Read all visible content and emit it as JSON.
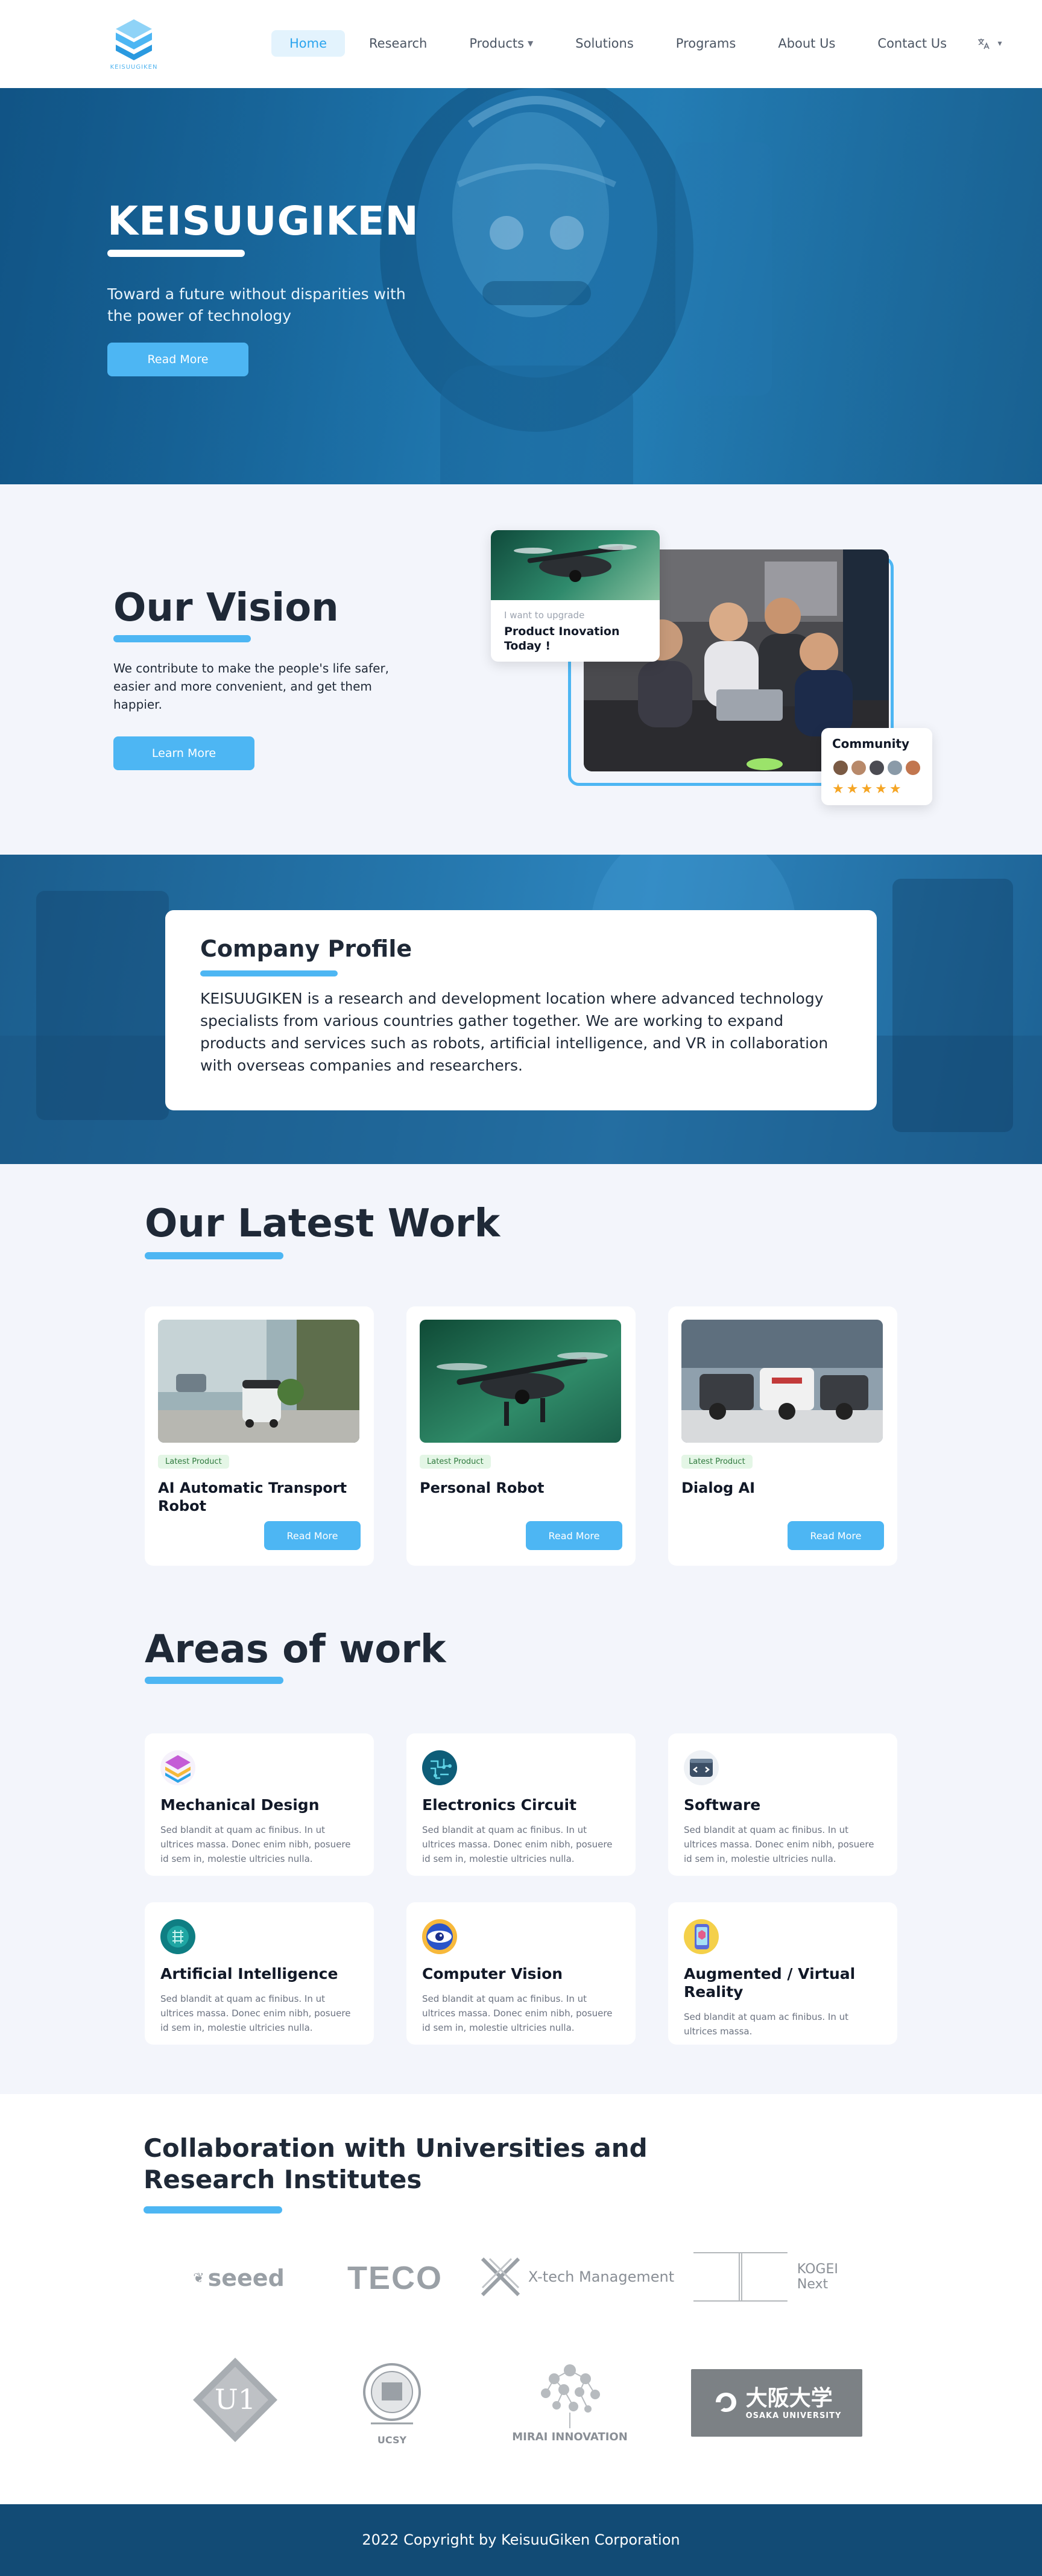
{
  "brand": {
    "logo_text": "KEISUUGIKEN",
    "accent": "#4db6f3"
  },
  "nav": {
    "items": [
      {
        "label": "Home",
        "active": true
      },
      {
        "label": "Research"
      },
      {
        "label": "Products",
        "dropdown": true
      },
      {
        "label": "Solutions"
      },
      {
        "label": "Programs"
      },
      {
        "label": "About Us"
      },
      {
        "label": "Contact Us"
      }
    ],
    "language_icon": "translate-icon"
  },
  "hero": {
    "title": "KEISUUGIKEN",
    "subtitle": "Toward a future without disparities with the power of technology",
    "button": "Read More"
  },
  "vision": {
    "title": "Our Vision",
    "text": "We contribute to make the people's life safer, easier and more convenient, and get them happier.",
    "button": "Learn More",
    "upgrade_small": "I want to upgrade",
    "upgrade_big": "Product Inovation Today !",
    "community_title": "Community",
    "rating": 5
  },
  "profile": {
    "title": "Company Profile",
    "text": "KEISUUGIKEN is a research and development location where advanced technology specialists from various countries gather together. We are working to expand products and services such as robots, artificial intelligence, and VR in collaboration with overseas companies and researchers."
  },
  "latest": {
    "title": "Our Latest Work",
    "cards": [
      {
        "tag": "Latest Product",
        "title": "AI Automatic Transport Robot",
        "button": "Read More"
      },
      {
        "tag": "Latest Product",
        "title": "Personal Robot",
        "button": "Read More"
      },
      {
        "tag": "Latest Product",
        "title": "Dialog AI",
        "button": "Read More"
      }
    ]
  },
  "areas": {
    "title": "Areas of work",
    "cards": [
      {
        "title": "Mechanical Design",
        "desc": "Sed blandit at quam ac finibus. In ut ultrices massa. Donec enim nibh, posuere id sem in, molestie ultricies nulla.",
        "icon": "layers-icon"
      },
      {
        "title": "Electronics Circuit",
        "desc": "Sed blandit at quam ac finibus. In ut ultrices massa. Donec enim nibh, posuere id sem in, molestie ultricies nulla.",
        "icon": "circuit-icon"
      },
      {
        "title": "Software",
        "desc": "Sed blandit at quam ac finibus. In ut ultrices massa. Donec enim nibh, posuere id sem in, molestie ultricies nulla.",
        "icon": "code-icon"
      },
      {
        "title": "Artificial Intelligence",
        "desc": "Sed blandit at quam ac finibus. In ut ultrices massa. Donec enim nibh, posuere id sem in, molestie ultricies nulla.",
        "icon": "ai-chip-icon"
      },
      {
        "title": "Computer Vision",
        "desc": "Sed blandit at quam ac finibus. In ut ultrices massa. Donec enim nibh, posuere id sem in, molestie ultricies nulla.",
        "icon": "vision-eye-icon"
      },
      {
        "title": "Augmented / Virtual Reality",
        "desc": "Sed blandit at quam ac finibus. In ut ultrices massa.",
        "icon": "ar-vr-icon"
      }
    ]
  },
  "collab": {
    "title": "Collaboration with Universities and Research Institutes",
    "logos": [
      "seeed",
      "TECO",
      "X-tech Management",
      "KOGEI Next",
      "UCSY",
      "MIRAI INNOVATION",
      "大阪大学",
      "OSAKA UNIVERSITY"
    ]
  },
  "footer": {
    "copyright": "2022 Copyright by KeisuuGiken Corporation"
  }
}
